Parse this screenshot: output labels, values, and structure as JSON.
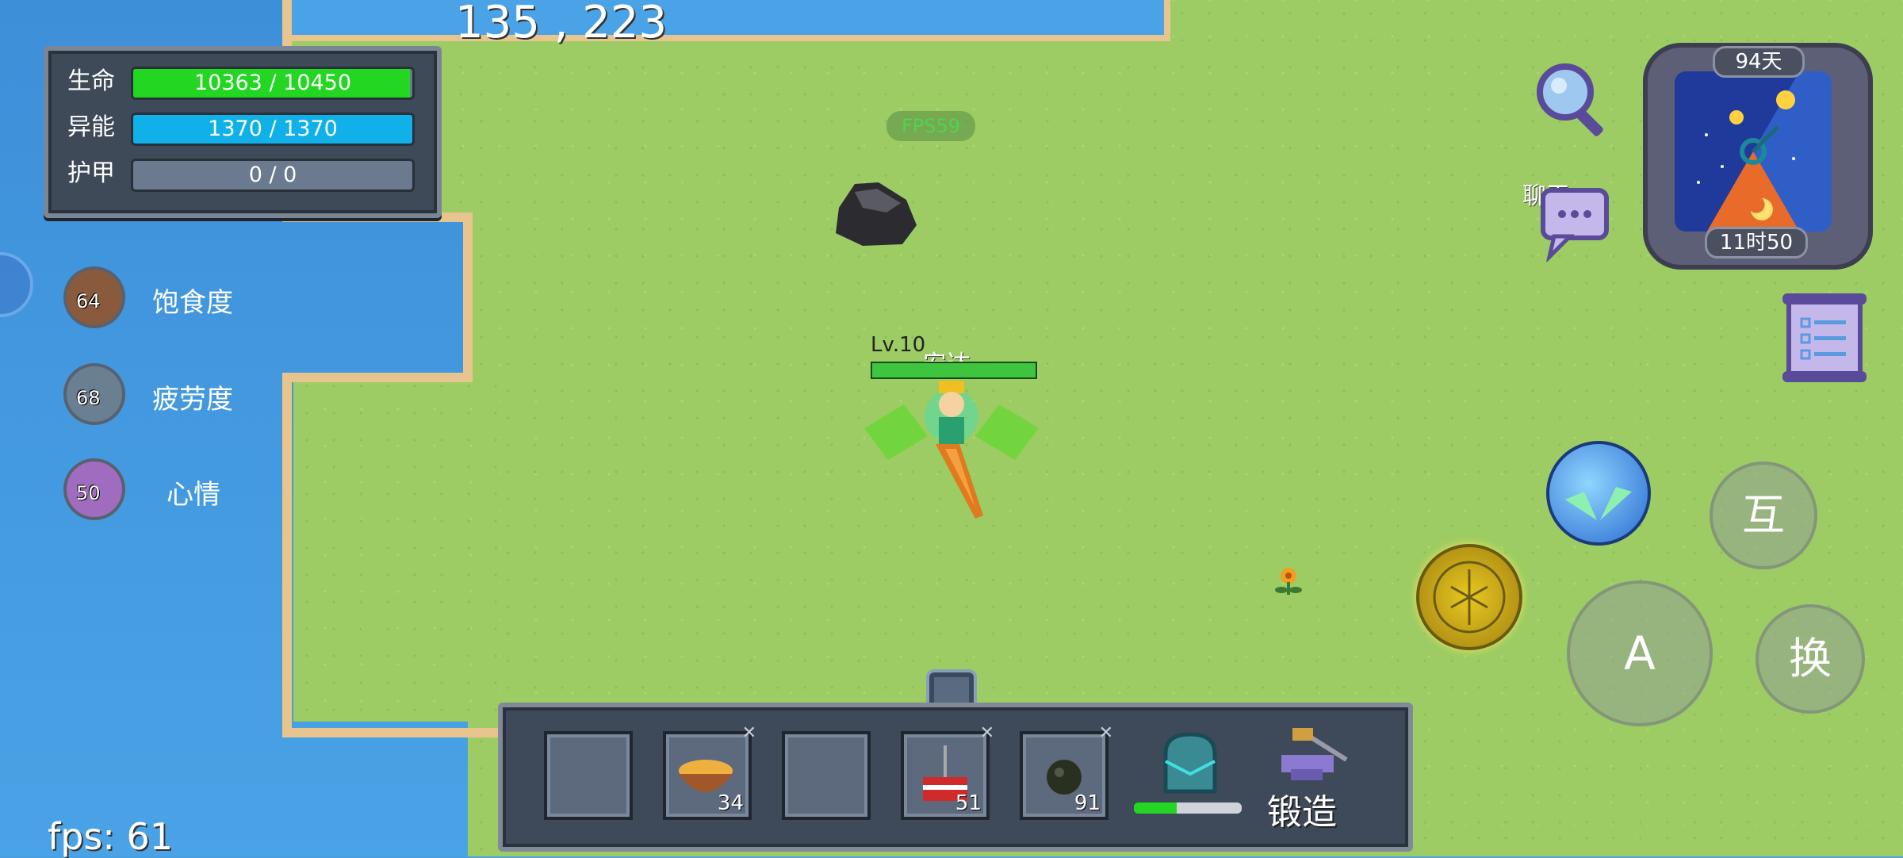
{
  "coords": "135 , 223",
  "fps_overlay": "FPS59",
  "fps_bottom": "fps: 61",
  "stats": [
    {
      "label": "生命",
      "value": "10363 / 10450",
      "fill": 0.992,
      "color": "#22d622"
    },
    {
      "label": "异能",
      "value": "1370 / 1370",
      "fill": 1.0,
      "color": "#10b0e8"
    },
    {
      "label": "护甲",
      "value": "0 / 0",
      "fill": 0.0,
      "color": "#6b7a8e"
    }
  ],
  "needs": [
    {
      "label": "饱食度",
      "value": "64",
      "icon": "food-icon"
    },
    {
      "label": "疲劳度",
      "value": "68",
      "icon": "fatigue-icon"
    },
    {
      "label": "心情",
      "value": "50",
      "icon": "heart-icon"
    }
  ],
  "clock": {
    "day": "94天",
    "time": "11时50"
  },
  "chat_label": "聊天",
  "player": {
    "level": "Lv.10",
    "name": "安达"
  },
  "hotbar": [
    {
      "icon": "empty-slot",
      "count": ""
    },
    {
      "icon": "food-bowl-icon",
      "count": "34"
    },
    {
      "icon": "empty-slot",
      "count": ""
    },
    {
      "icon": "dynamite-icon",
      "count": "51"
    },
    {
      "icon": "bomb-icon",
      "count": "91"
    }
  ],
  "backpack_progress": 0.4,
  "forge_label": "锻造",
  "buttons": {
    "interact": "互",
    "attack": "A",
    "swap": "换"
  }
}
